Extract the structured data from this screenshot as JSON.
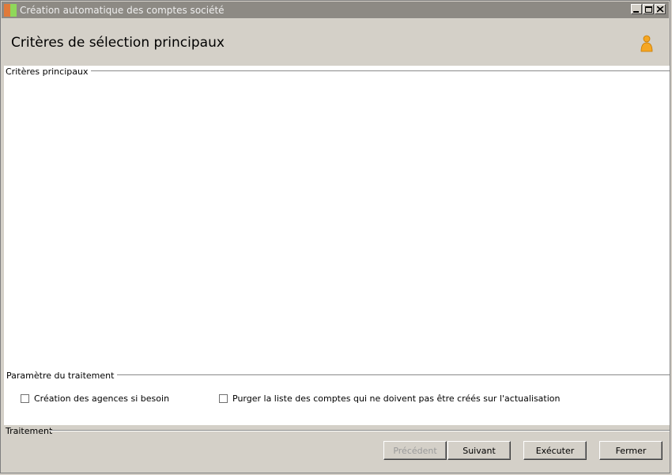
{
  "window": {
    "title": "Création automatique des comptes société"
  },
  "header": {
    "title": "Critères de sélection principaux"
  },
  "groups": {
    "main_criteria": "Critères principaux",
    "processing_params": "Paramètre du traitement",
    "processing": "Traitement"
  },
  "options": {
    "create_agencies": {
      "label": "Création des agences si besoin",
      "checked": false
    },
    "purge_list": {
      "label": "Purger la liste des comptes qui ne doivent pas être créés sur l'actualisation",
      "checked": false
    }
  },
  "buttons": {
    "previous": "Précédent",
    "next": "Suivant",
    "execute": "Exécuter",
    "close": "Fermer"
  },
  "colors": {
    "titlebar": "#8d8a84",
    "user_icon": "#f0a020"
  }
}
